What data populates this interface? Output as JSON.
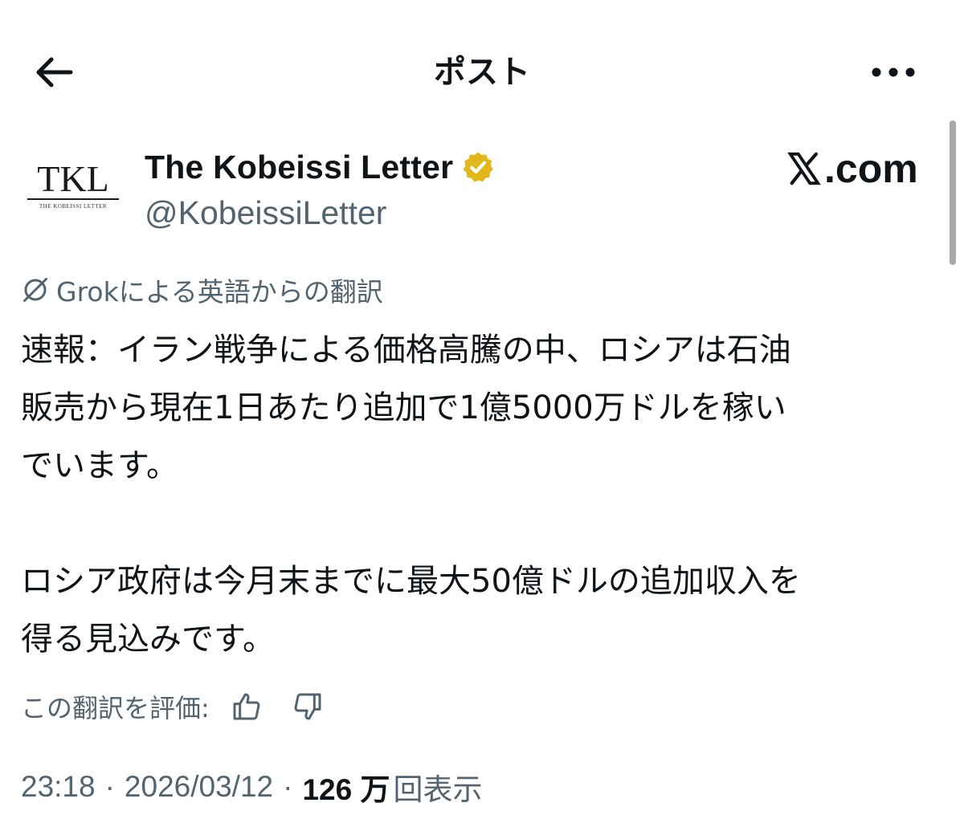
{
  "header": {
    "title": "ポスト"
  },
  "author": {
    "avatar_text": "TKL",
    "avatar_subtext": "THE KOBEISSI LETTER",
    "name": "The Kobeissi Letter",
    "handle": "@KobeissiLetter",
    "verified_color": "#e2b719"
  },
  "watermark": {
    "text": ".com"
  },
  "translation": {
    "label": "Grokによる英語からの翻訳"
  },
  "post": {
    "paragraph1_line1": "速報：イラン戦争による価格高騰の中、ロシアは石油",
    "paragraph1_line2": "販売から現在1日あたり追加で1億5000万ドルを稼い",
    "paragraph1_line3": "でいます。",
    "paragraph2_line1": "ロシア政府は今月末までに最大50億ドルの追加収入を",
    "paragraph2_line2": "得る見込みです。"
  },
  "rating": {
    "label": "この翻訳を評価:"
  },
  "meta": {
    "time": "23:18",
    "separator": "·",
    "date": "2026/03/12",
    "views_count": "126 万",
    "views_label": "回表示"
  },
  "icons": {
    "back": "arrow-left-icon",
    "more": "more-horizontal-icon",
    "verified": "verified-badge-icon",
    "grok": "grok-icon",
    "thumbs_up": "thumbs-up-icon",
    "thumbs_down": "thumbs-down-icon",
    "x_logo": "x-logo-icon"
  }
}
